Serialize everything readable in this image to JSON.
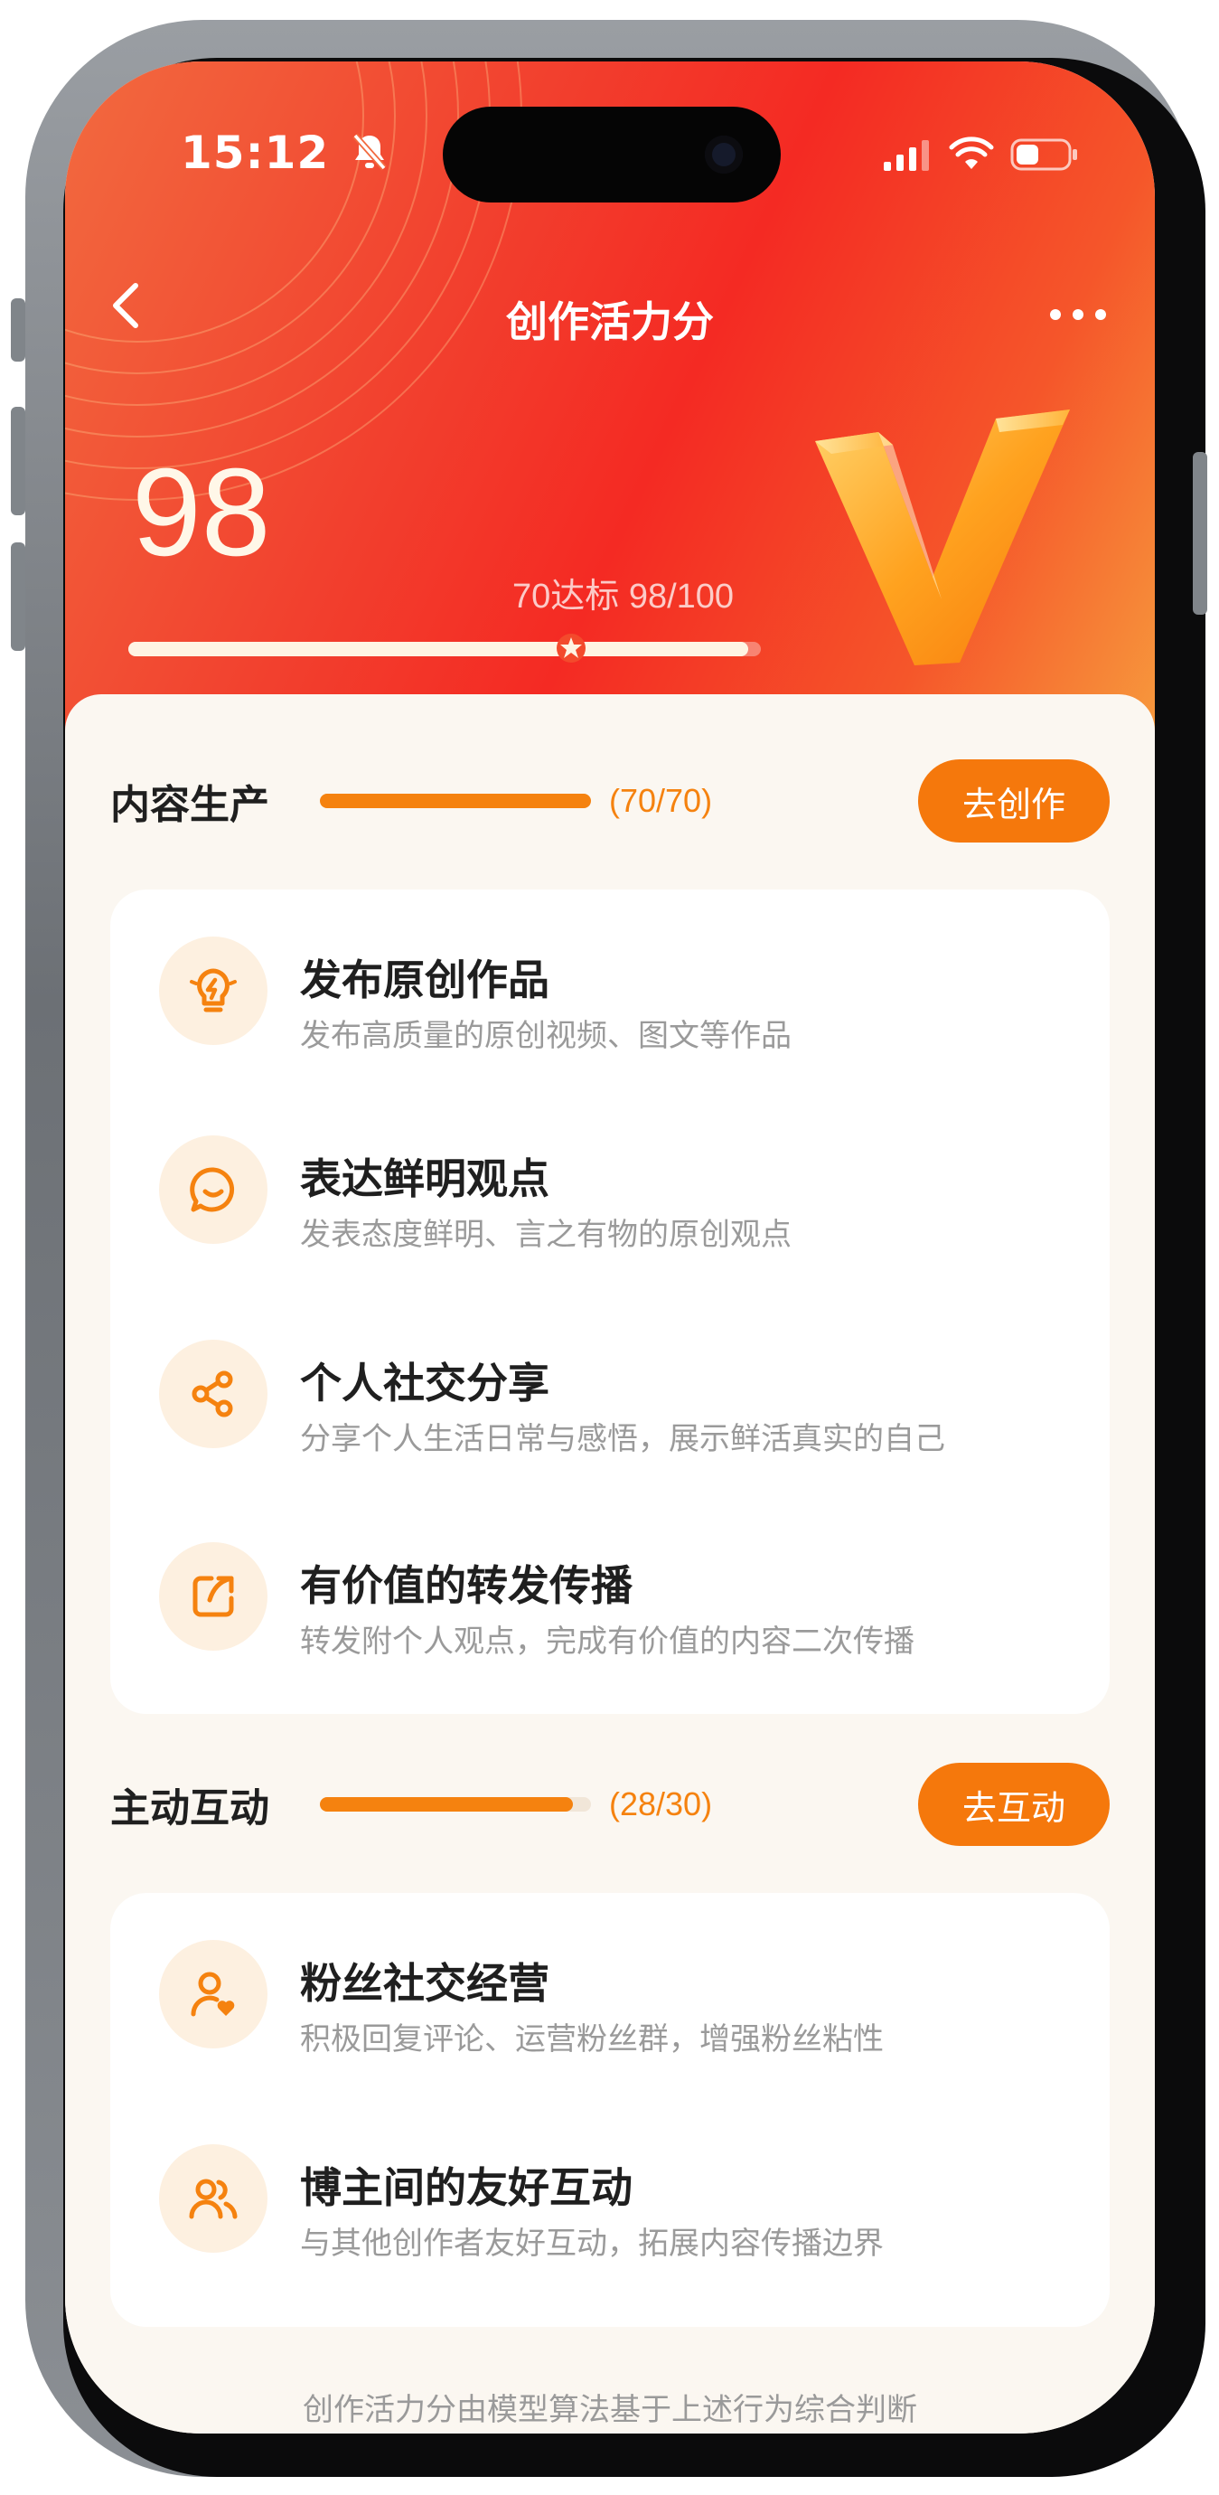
{
  "status_bar": {
    "time": "15:12"
  },
  "nav": {
    "title": "创作活力分"
  },
  "score": {
    "value": "98",
    "target_text": "70达标 98/100",
    "progress_fraction": 0.98,
    "target_fraction": 0.7
  },
  "sections": [
    {
      "title": "内容生产",
      "count": "(70/70)",
      "progress_fraction": 1.0,
      "button": "去创作",
      "items": [
        {
          "title": "发布原创作品",
          "desc": "发布高质量的原创视频、图文等作品",
          "icon": "lightbulb-icon"
        },
        {
          "title": "表达鲜明观点",
          "desc": "发表态度鲜明、言之有物的原创观点",
          "icon": "speech-bubble-icon"
        },
        {
          "title": "个人社交分享",
          "desc": "分享个人生活日常与感悟，展示鲜活真实的自己",
          "icon": "share-icon"
        },
        {
          "title": "有价值的转发传播",
          "desc": "转发附个人观点，完成有价值的内容二次传播",
          "icon": "forward-icon"
        }
      ]
    },
    {
      "title": "主动互动",
      "count": "(28/30)",
      "progress_fraction": 0.9333,
      "button": "去互动",
      "items": [
        {
          "title": "粉丝社交经营",
          "desc": "积极回复评论、运营粉丝群，增强粉丝粘性",
          "icon": "user-heart-icon"
        },
        {
          "title": "博主间的友好互动",
          "desc": "与其他创作者友好互动，拓展内容传播边界",
          "icon": "users-icon"
        }
      ]
    }
  ],
  "footer": {
    "note": "创作活力分由模型算法基于上述行为综合判断"
  },
  "colors": {
    "accent": "#f5780c",
    "hero_red": "#f42a23",
    "icon_bg": "#fdf0e0"
  }
}
